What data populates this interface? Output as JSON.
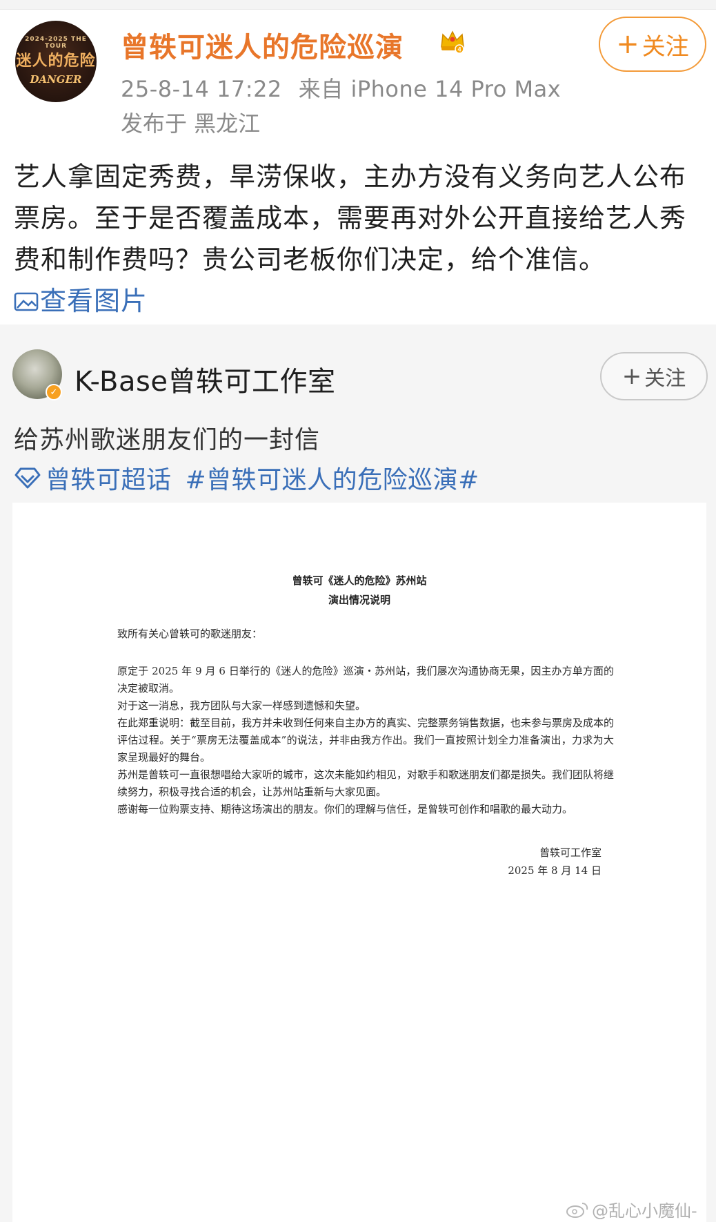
{
  "post1": {
    "avatar": {
      "top_text": "2024-2025 THE TOUR",
      "main_text": "迷人的危险",
      "sub_text": "DANGER"
    },
    "author": "曾轶可迷人的危险巡演",
    "follow_label": "关注",
    "time": "25-8-14 17:22",
    "source": "来自 iPhone 14 Pro Max",
    "location": "发布于 黑龙江",
    "text": "艺人拿固定秀费，旱涝保收，主办方没有义务向艺人公布票房。至于是否覆盖成本，需要再对外公开直接给艺人秀费和制作费吗？贵公司老板你们决定，给个准信。",
    "see_image": "查看图片"
  },
  "post2": {
    "author": "K-Base曾轶可工作室",
    "follow_label": "关注",
    "text": "给苏州歌迷朋友们的一封信",
    "topic1": "曾轶可超话",
    "topic2": "#曾轶可迷人的危险巡演#"
  },
  "document": {
    "title_line1": "曾轶可《迷人的危险》苏州站",
    "title_line2": "演出情况说明",
    "greeting": "致所有关心曾轶可的歌迷朋友：",
    "p1": "原定于 2025 年 9 月 6 日举行的《迷人的危险》巡演・苏州站，我们屡次沟通协商无果，因主办方单方面的决定被取消。",
    "p2": "对于这一消息，我方团队与大家一样感到遗憾和失望。",
    "p3": "在此郑重说明：截至目前，我方并未收到任何来自主办方的真实、完整票务销售数据，也未参与票房及成本的评估过程。关于“票房无法覆盖成本”的说法，并非由我方作出。我们一直按照计划全力准备演出，力求为大家呈现最好的舞台。",
    "p4": "苏州是曾轶可一直很想唱给大家听的城市，这次未能如约相见，对歌手和歌迷朋友们都是损失。我们团队将继续努力，积极寻找合适的机会，让苏州站重新与大家见面。",
    "p5": "感谢每一位购票支持、期待这场演出的朋友。你们的理解与信任，是曾轶可创作和唱歌的最大动力。",
    "signature": "曾轶可工作室",
    "date": "2025 年 8 月 14 日"
  },
  "watermark": "@乱心小魔仙-",
  "colors": {
    "accent_orange": "#e8762a",
    "link_blue": "#3a6fb8",
    "meta_gray": "#8a8a8a"
  }
}
